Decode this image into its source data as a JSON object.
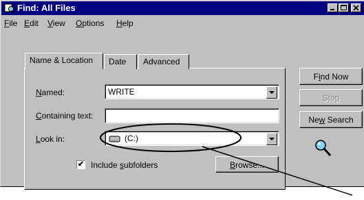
{
  "window": {
    "title": "Find: All Files"
  },
  "menu": [
    {
      "pre": "",
      "key": "F",
      "rest": "ile"
    },
    {
      "pre": "",
      "key": "E",
      "rest": "dit"
    },
    {
      "pre": "",
      "key": "V",
      "rest": "iew"
    },
    {
      "pre": "",
      "key": "O",
      "rest": "ptions"
    },
    {
      "pre": "",
      "key": "H",
      "rest": "elp"
    }
  ],
  "tabs": [
    "Name & Location",
    "Date",
    "Advanced"
  ],
  "form": {
    "named": {
      "key": "N",
      "rest": "amed:",
      "value": "WRITE"
    },
    "containing": {
      "key": "C",
      "rest": "ontaining text:",
      "value": ""
    },
    "lookin": {
      "key": "L",
      "rest": "ook in:",
      "value": "(C:)"
    },
    "subfolders": {
      "pre": "Include ",
      "key": "s",
      "rest": "ubfolders",
      "checked": "✔"
    },
    "browse": {
      "key": "B",
      "rest": "rowse..."
    }
  },
  "buttons": {
    "findnow": {
      "pre": "F",
      "key": "i",
      "rest": "nd Now"
    },
    "stop": {
      "pre": "Sto",
      "key": "p",
      "rest": ""
    },
    "newsearch": {
      "pre": "Ne",
      "key": "w",
      "rest": " Search"
    }
  },
  "colors": {
    "titlebar": "#000080",
    "face": "#c0c0c0"
  }
}
